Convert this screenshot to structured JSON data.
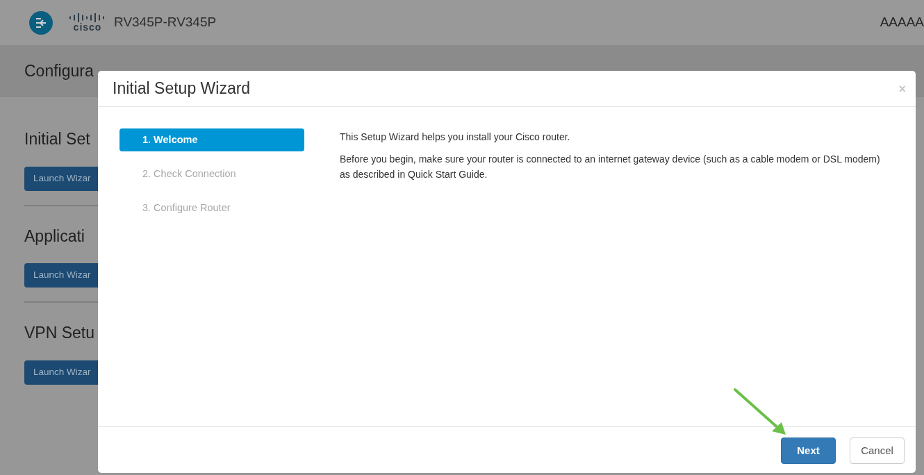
{
  "header": {
    "logo_text": "cisco",
    "device_name": "RV345P-RV345P",
    "user": "AAAAA"
  },
  "page_title": "Configura",
  "sections": [
    {
      "title": "Initial Set",
      "button": "Launch Wizar"
    },
    {
      "title": "Applicati",
      "button": "Launch Wizar"
    },
    {
      "title": "VPN Setu",
      "button": "Launch Wizar"
    }
  ],
  "dialog": {
    "title": "Initial Setup Wizard",
    "close": "×",
    "steps": [
      {
        "label": "1. Welcome",
        "selected": true
      },
      {
        "label": "2. Check Connection",
        "selected": false
      },
      {
        "label": "3. Configure Router",
        "selected": false
      }
    ],
    "paragraphs": [
      "This Setup Wizard helps you install your Cisco router.",
      "Before you begin, make sure your router is connected to an internet gateway device (such as a cable modem or DSL modem) as described in Quick Start Guide."
    ],
    "buttons": [
      {
        "label": "Next",
        "kind": "primary"
      },
      {
        "label": "Cancel",
        "kind": "default"
      }
    ]
  }
}
